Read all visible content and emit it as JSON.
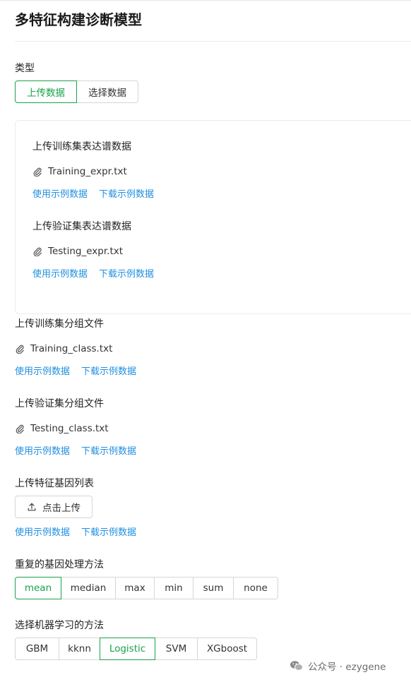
{
  "page": {
    "title": "多特征构建诊断模型"
  },
  "type_section": {
    "label": "类型",
    "options": [
      "上传数据",
      "选择数据"
    ],
    "selected": "上传数据"
  },
  "card": {
    "train_expr": {
      "label": "上传训练集表达谱数据",
      "file": "Training_expr.txt"
    },
    "test_expr": {
      "label": "上传验证集表达谱数据",
      "file": "Testing_expr.txt"
    }
  },
  "train_class": {
    "label": "上传训练集分组文件",
    "file": "Training_class.txt"
  },
  "test_class": {
    "label": "上传验证集分组文件",
    "file": "Testing_class.txt"
  },
  "gene_list": {
    "label": "上传特征基因列表",
    "upload_button": "点击上传"
  },
  "links": {
    "use_example": "使用示例数据",
    "download_example": "下载示例数据"
  },
  "duplicate_method": {
    "label": "重复的基因处理方法",
    "options": [
      "mean",
      "median",
      "max",
      "min",
      "sum",
      "none"
    ],
    "selected": "mean"
  },
  "ml_method": {
    "label": "选择机器学习的方法",
    "options": [
      "GBM",
      "kknn",
      "Logistic",
      "SVM",
      "XGboost"
    ],
    "selected": "Logistic"
  },
  "watermark": {
    "text": "公众号 · ezygene"
  },
  "colors": {
    "accent_green": "#1aa24a",
    "link_blue": "#1e8fe1"
  },
  "icons": {
    "file": "paperclip-icon",
    "upload": "upload-icon",
    "watermark": "wechat-icon"
  }
}
